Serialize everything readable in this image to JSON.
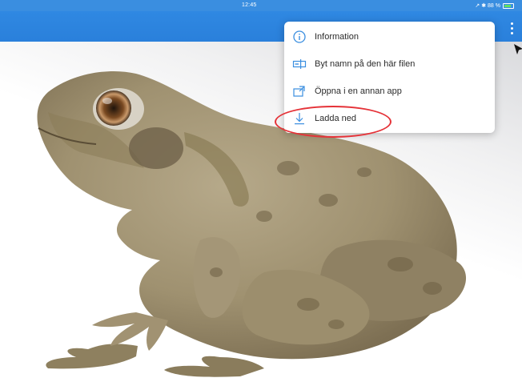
{
  "statusbar": {
    "time": "12:45",
    "status_text": "↗ ✱ 88 %"
  },
  "menu": {
    "items": [
      {
        "label": "Information",
        "icon": "info-icon"
      },
      {
        "label": "Byt namn på den här filen",
        "icon": "rename-icon"
      },
      {
        "label": "Öppna i en annan app",
        "icon": "open-in-app-icon"
      },
      {
        "label": "Ladda ned",
        "icon": "download-icon"
      }
    ]
  },
  "colors": {
    "app_bar": "#2f88e2",
    "icon_blue": "#3a8ee0",
    "annotation_red": "#e53238"
  }
}
